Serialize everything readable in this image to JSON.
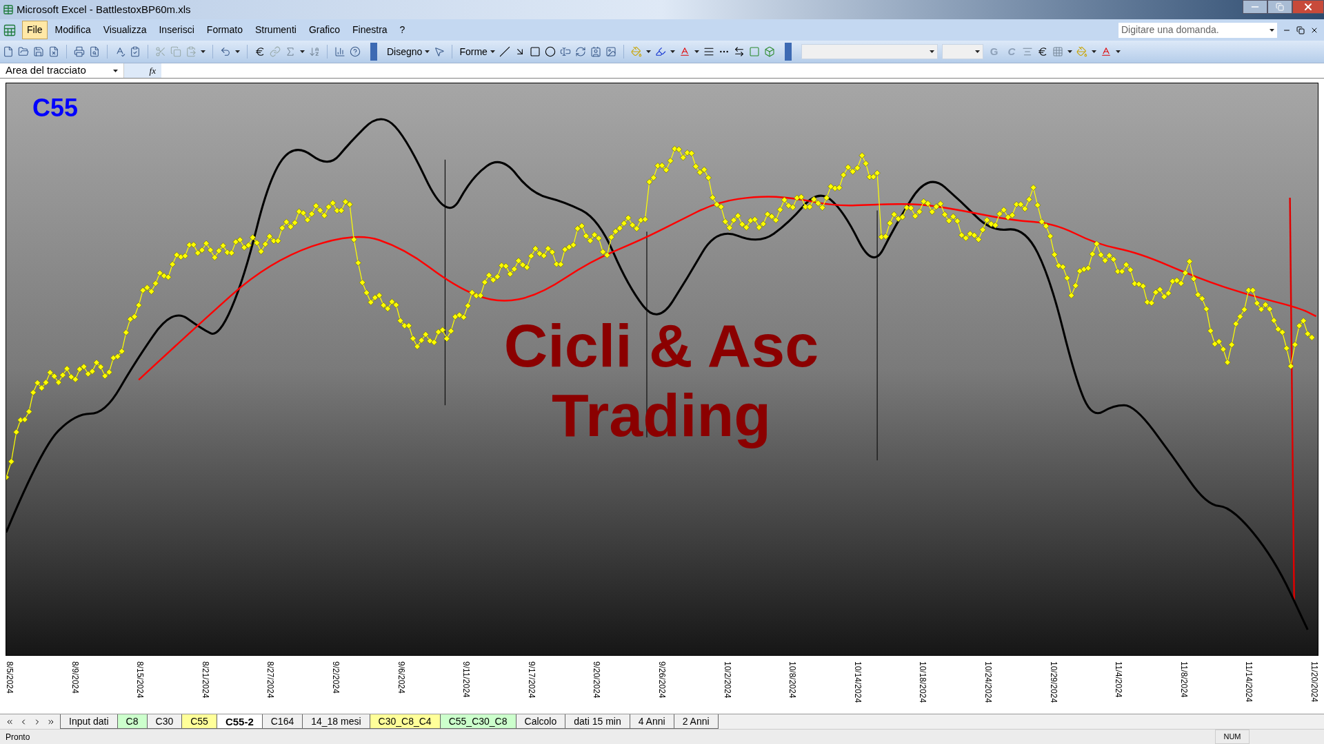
{
  "window": {
    "title": "Microsoft Excel - BattlestoxBP60m.xls"
  },
  "menu": [
    {
      "label": "File",
      "selected": true
    },
    {
      "label": "Modifica",
      "selected": false
    },
    {
      "label": "Visualizza",
      "selected": false
    },
    {
      "label": "Inserisci",
      "selected": false
    },
    {
      "label": "Formato",
      "selected": false
    },
    {
      "label": "Strumenti",
      "selected": false
    },
    {
      "label": "Grafico",
      "selected": false
    },
    {
      "label": "Finestra",
      "selected": false
    },
    {
      "label": "?",
      "selected": false
    }
  ],
  "help_field": {
    "placeholder": "Digitare una domanda."
  },
  "toolbar_menus": [
    "Disegno",
    "Forme"
  ],
  "format_buttons": [
    {
      "label": "G",
      "disabled": true
    },
    {
      "label": "C",
      "disabled": true
    }
  ],
  "name_box": {
    "value": "Area del tracciato"
  },
  "formula_label": "fx",
  "chart": {
    "title": "C55",
    "overlay_text": [
      "Cicli & Asc",
      "Trading"
    ],
    "x_labels": [
      "8/5/2024",
      "8/9/2024",
      "8/15/2024",
      "8/21/2024",
      "8/27/2024",
      "9/2/2024",
      "9/6/2024",
      "9/11/2024",
      "9/17/2024",
      "9/20/2024",
      "9/26/2024",
      "10/2/2024",
      "10/8/2024",
      "10/14/2024",
      "10/18/2024",
      "10/24/2024",
      "10/29/2024",
      "11/4/2024",
      "11/8/2024",
      "11/14/2024",
      "11/20/2024"
    ]
  },
  "sheet_tabs": [
    {
      "label": "Input dati",
      "selected": false,
      "color": "#f0f0f0"
    },
    {
      "label": "C8",
      "selected": false,
      "color": "#ccffcc"
    },
    {
      "label": "C30",
      "selected": false,
      "color": "#f0f0f0"
    },
    {
      "label": "C55",
      "selected": false,
      "color": "#ffff99"
    },
    {
      "label": "C55-2",
      "selected": true,
      "color": "#ffffff"
    },
    {
      "label": "C164",
      "selected": false,
      "color": "#f0f0f0"
    },
    {
      "label": "14_18 mesi",
      "selected": false,
      "color": "#f0f0f0"
    },
    {
      "label": "C30_C8_C4",
      "selected": false,
      "color": "#ffff99"
    },
    {
      "label": "C55_C30_C8",
      "selected": false,
      "color": "#ccffcc"
    },
    {
      "label": "Calcolo",
      "selected": false,
      "color": "#f0f0f0"
    },
    {
      "label": "dati 15 min",
      "selected": false,
      "color": "#f0f0f0"
    },
    {
      "label": "4 Anni",
      "selected": false,
      "color": "#f0f0f0"
    },
    {
      "label": "2 Anni",
      "selected": false,
      "color": "#f0f0f0"
    }
  ],
  "status_bar": {
    "text": "Pronto",
    "indicators": [
      "NUM"
    ]
  }
}
